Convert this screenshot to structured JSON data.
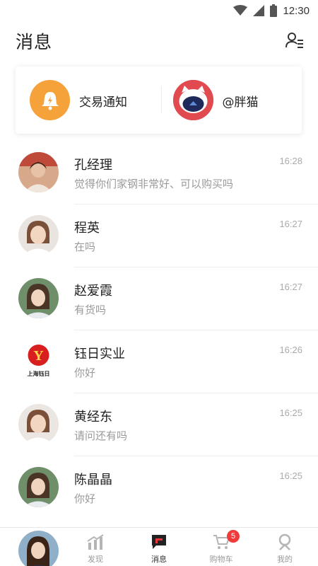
{
  "status_bar": {
    "time": "12:30"
  },
  "header": {
    "title": "消息"
  },
  "quick_actions": [
    {
      "label": "交易通知"
    },
    {
      "label": "@胖猫"
    }
  ],
  "conversations": [
    {
      "name": "孔经理",
      "time": "16:28",
      "preview": "觉得你们家钢非常好、可以购买吗"
    },
    {
      "name": "程英",
      "time": "16:27",
      "preview": "在吗"
    },
    {
      "name": "赵爱霞",
      "time": "16:27",
      "preview": "有货吗"
    },
    {
      "name": "钰日实业",
      "time": "16:26",
      "preview": "你好",
      "logo_caption": "上海钰日"
    },
    {
      "name": "黄经东",
      "time": "16:25",
      "preview": "请问还有吗"
    },
    {
      "name": "陈晶晶",
      "time": "16:25",
      "preview": "你好"
    }
  ],
  "tab_bar": {
    "tabs": [
      {
        "label": "发现",
        "icon": "discover-chart-icon"
      },
      {
        "label": "消息",
        "icon": "message-icon",
        "active": true
      },
      {
        "label": "购物车",
        "icon": "cart-icon",
        "badge": "5"
      },
      {
        "label": "我的",
        "icon": "profile-icon"
      }
    ]
  },
  "colors": {
    "accent": "#e8373c",
    "notify_orange": "#f5a23a",
    "cat_red": "#e14b4f",
    "badge_red": "#f03b3b"
  }
}
